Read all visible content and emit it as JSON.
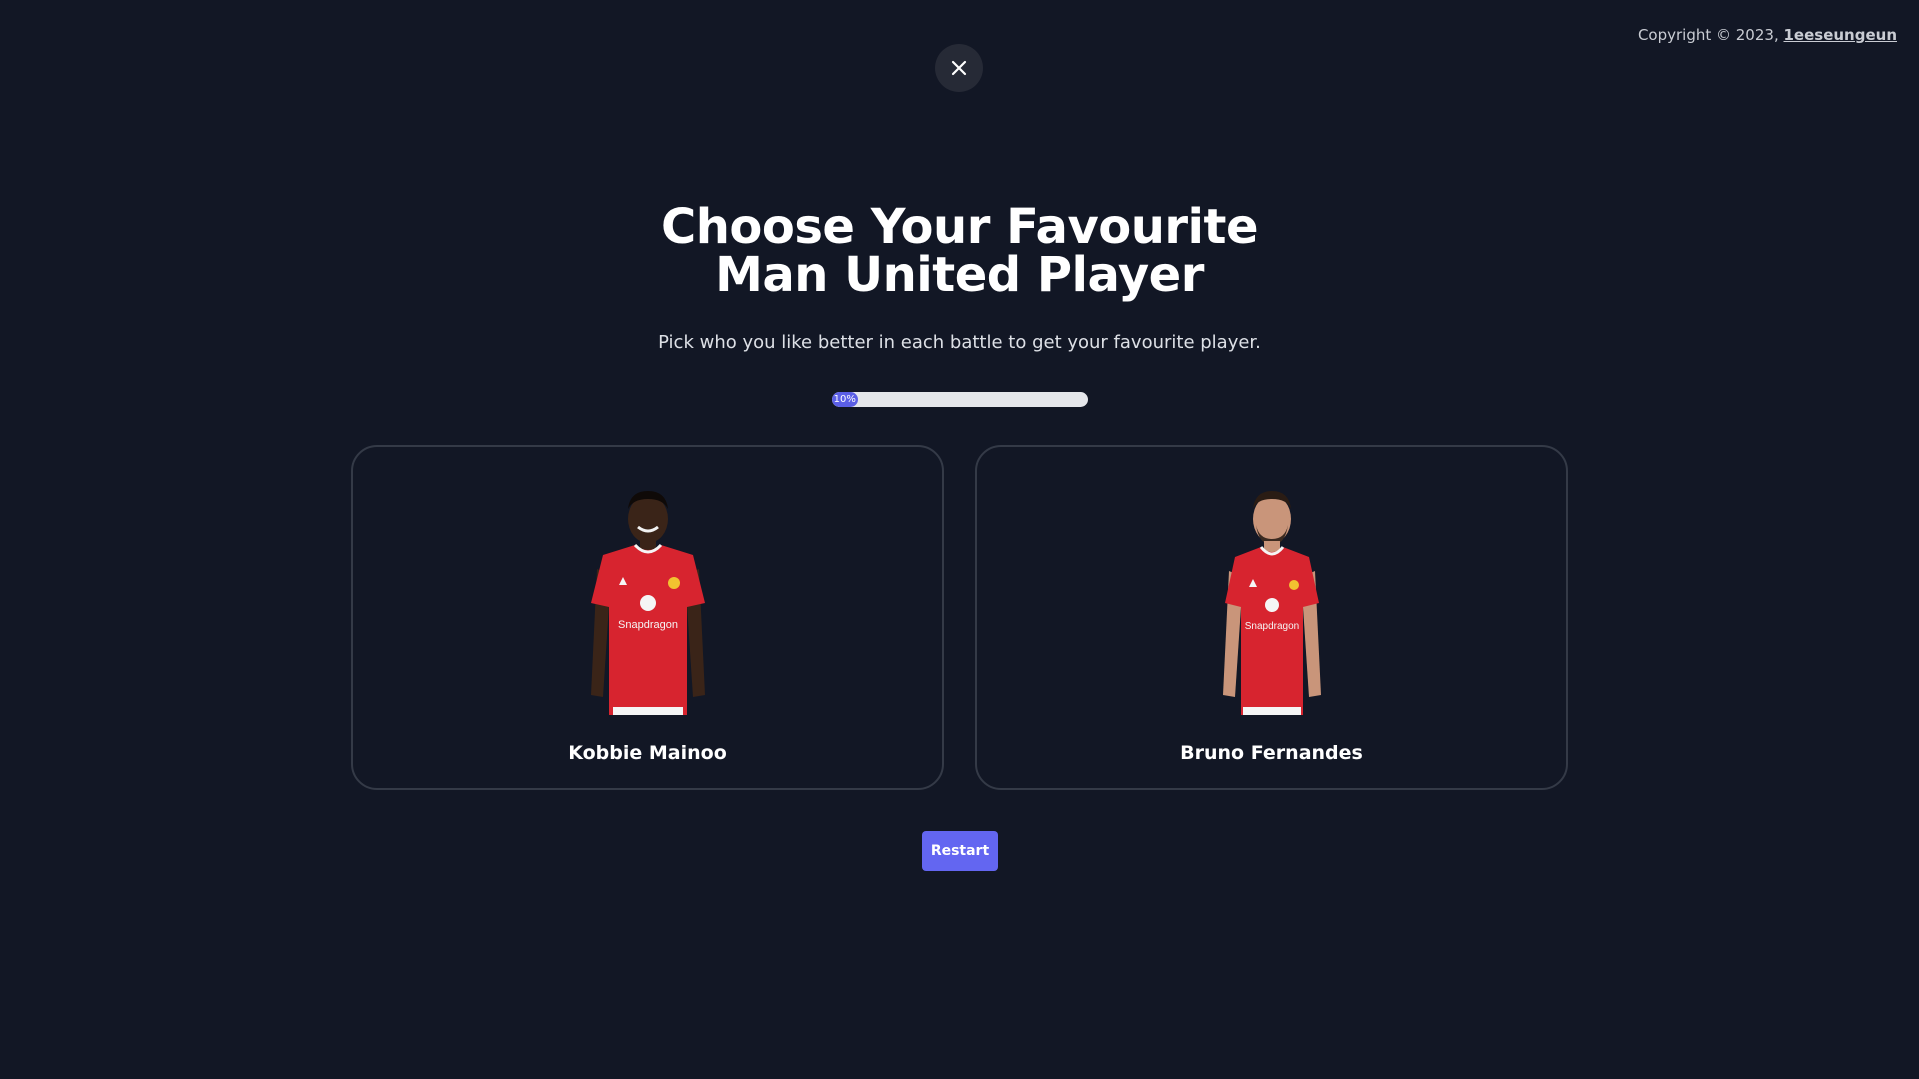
{
  "copyright": {
    "prefix": "Copyright © 2023, ",
    "author": "1eeseungeun"
  },
  "close_icon": "close-icon",
  "title": {
    "line1": "Choose Your Favourite",
    "line2": "Man United Player"
  },
  "subtitle": "Pick who you like better in each battle to get your favourite player.",
  "progress": {
    "label": "10%",
    "fraction": 0.1
  },
  "players": [
    {
      "name": "Kobbie Mainoo"
    },
    {
      "name": "Bruno Fernandes"
    }
  ],
  "restart_label": "Restart",
  "colors": {
    "background": "#121725",
    "accent": "#6366f1",
    "kit_red": "#d7242f"
  }
}
